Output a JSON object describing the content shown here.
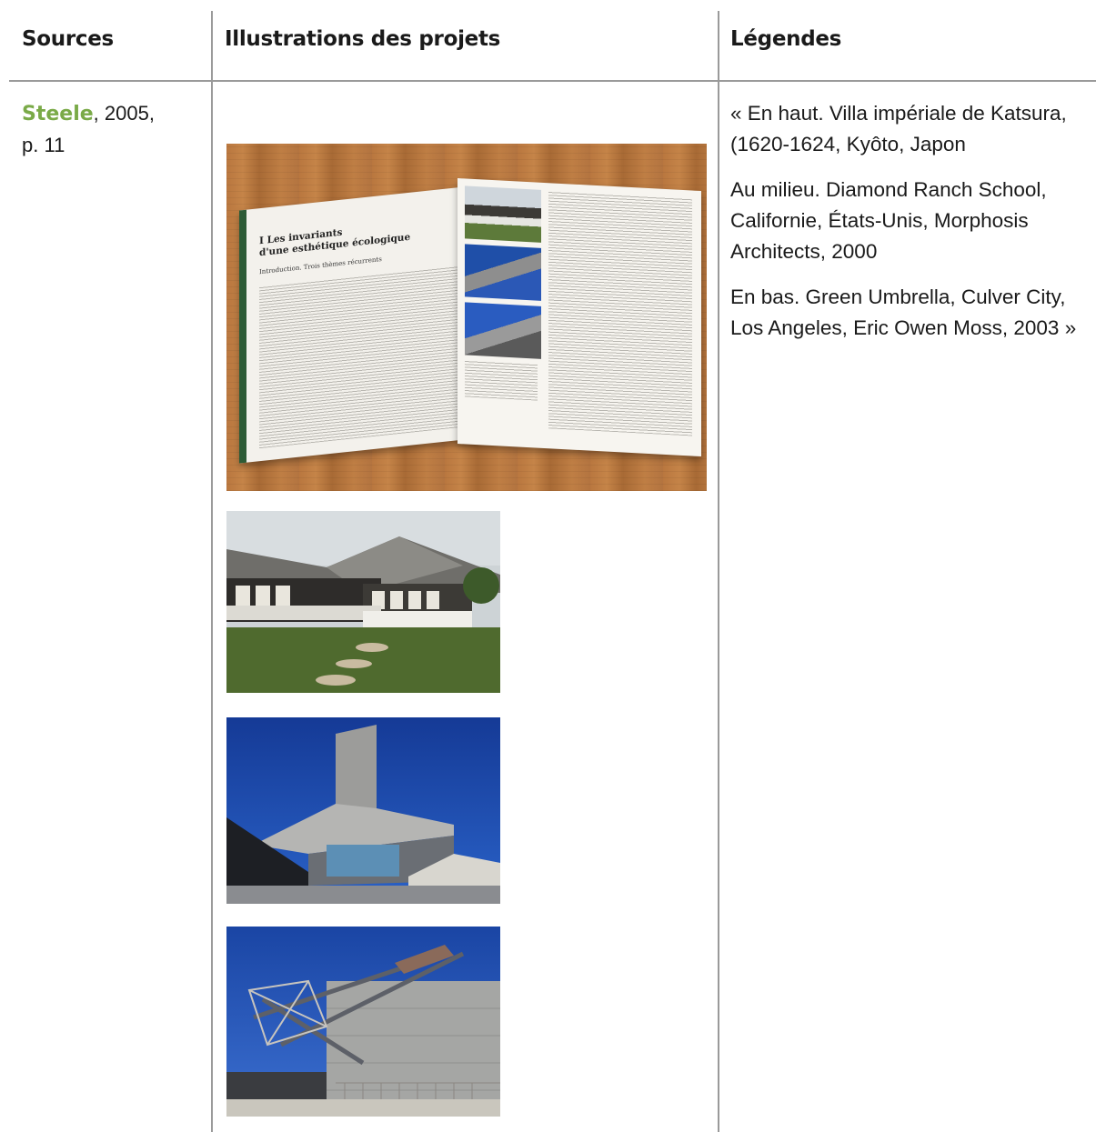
{
  "table": {
    "headers": [
      "Sources",
      "Illustrations des projets",
      "Légendes"
    ],
    "row": {
      "source": {
        "author": "Steele",
        "year_text": ", 2005,",
        "page": "p. 11"
      },
      "legend": {
        "top": "« En haut. Villa impériale de Katsura, (1620-1624, Kyôto, Japon",
        "middle": "Au milieu. Diamond Ranch School, Californie, États-Unis, Morphosis Architects, 2000",
        "bottom": "En bas. Green Umbrella, Culver City, Los Angeles, Eric Owen Moss, 2003 »"
      },
      "book_photo": {
        "title": "I  Les invariants\nd'une esthétique écologique",
        "subtitle": "Introduction. Trois thèmes récurrents"
      }
    }
  },
  "colors": {
    "link": "#7aaa48",
    "rule": "#9a9a9a"
  }
}
